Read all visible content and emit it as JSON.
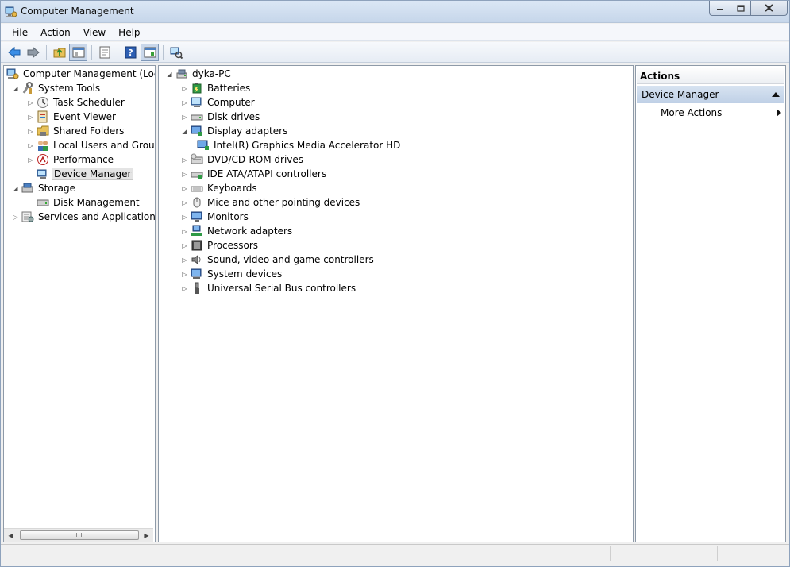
{
  "window": {
    "title": "Computer Management"
  },
  "menu": [
    "File",
    "Action",
    "View",
    "Help"
  ],
  "toolbar": {
    "buttons": [
      "back-icon",
      "forward-icon",
      "up-folder-icon",
      "show-hide-tree-icon",
      "properties-icon",
      "help-icon",
      "show-hide-action-pane-icon",
      "scan-hardware-icon"
    ]
  },
  "left_tree": {
    "root": "Computer Management (Local",
    "system_tools": "System Tools",
    "task_scheduler": "Task Scheduler",
    "event_viewer": "Event Viewer",
    "shared_folders": "Shared Folders",
    "local_users": "Local Users and Groups",
    "performance": "Performance",
    "device_manager": "Device Manager",
    "storage": "Storage",
    "disk_management": "Disk Management",
    "services": "Services and Applications"
  },
  "device_tree": {
    "computer_name": "dyka-PC",
    "categories": [
      {
        "label": "Batteries",
        "expanded": false
      },
      {
        "label": "Computer",
        "expanded": false
      },
      {
        "label": "Disk drives",
        "expanded": false
      },
      {
        "label": "Display adapters",
        "expanded": true
      },
      {
        "label": "Intel(R) Graphics Media Accelerator HD",
        "child": true
      },
      {
        "label": "DVD/CD-ROM drives",
        "expanded": false
      },
      {
        "label": "IDE ATA/ATAPI controllers",
        "expanded": false
      },
      {
        "label": "Keyboards",
        "expanded": false
      },
      {
        "label": "Mice and other pointing devices",
        "expanded": false
      },
      {
        "label": "Monitors",
        "expanded": false
      },
      {
        "label": "Network adapters",
        "expanded": false
      },
      {
        "label": "Processors",
        "expanded": false
      },
      {
        "label": "Sound, video and game controllers",
        "expanded": false
      },
      {
        "label": "System devices",
        "expanded": false
      },
      {
        "label": "Universal Serial Bus controllers",
        "expanded": false
      }
    ]
  },
  "actions": {
    "header": "Actions",
    "section": "Device Manager",
    "more_actions": "More Actions"
  },
  "scrollbar": {
    "thumb_grip": "III"
  },
  "colors": {
    "selection": "#e4e4e4",
    "actions_section": "#c8d7ea"
  }
}
